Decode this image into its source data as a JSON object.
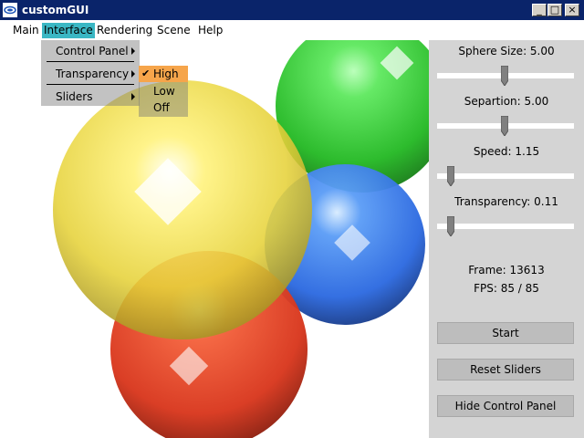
{
  "window": {
    "title": "customGUI"
  },
  "window_controls": {
    "minimize": "_",
    "maximize": "□",
    "close": "×"
  },
  "menubar": {
    "items": [
      {
        "label": "Main"
      },
      {
        "label": "Interface"
      },
      {
        "label": "Rendering"
      },
      {
        "label": "Scene"
      },
      {
        "label": "Help"
      }
    ]
  },
  "interface_menu": {
    "items": [
      {
        "label": "Control Panel"
      },
      {
        "label": "Transparency"
      },
      {
        "label": "Sliders"
      }
    ]
  },
  "transparency_submenu": {
    "items": [
      {
        "label": "High",
        "checked": true
      },
      {
        "label": "Low",
        "checked": false
      },
      {
        "label": "Off",
        "checked": false
      }
    ],
    "check_glyph": "✔"
  },
  "control_panel": {
    "sliders": [
      {
        "label": "Sphere Size: 5.00",
        "fraction": 0.49
      },
      {
        "label": "Separtion: 5.00",
        "fraction": 0.49
      },
      {
        "label": "Speed: 1.15",
        "fraction": 0.08
      },
      {
        "label": "Transparency: 0.11",
        "fraction": 0.08
      }
    ],
    "frame": "Frame: 13613",
    "fps": "FPS: 85 / 85",
    "buttons": {
      "start": "Start",
      "reset": "Reset Sliders",
      "hide": "Hide Control Panel"
    }
  },
  "colors": {
    "menu_highlight": "#3ab7c4",
    "submenu_selected": "#f6a54b",
    "panel_bg": "#d4d4d4",
    "button_bg": "#bdbdbd",
    "sphere_yellow": "#e8d640",
    "sphere_green": "#22c422",
    "sphere_blue": "#2a6ee8",
    "sphere_red": "#e83a1c"
  }
}
